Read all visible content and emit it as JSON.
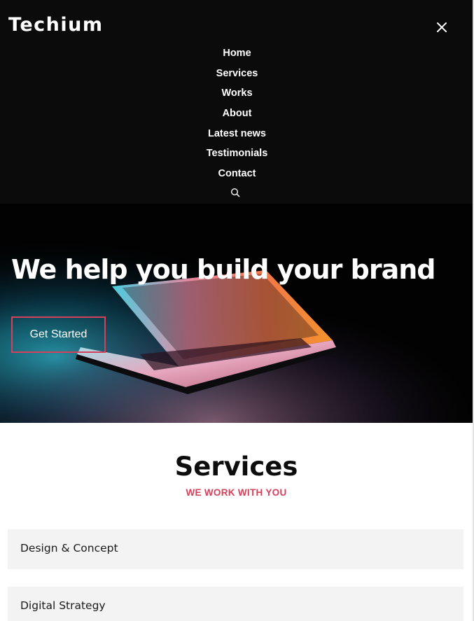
{
  "brand": {
    "logo_text": "Techium"
  },
  "nav": {
    "items": [
      "Home",
      "Services",
      "Works",
      "About",
      "Latest news",
      "Testimonials",
      "Contact"
    ]
  },
  "icons": {
    "close": "close-icon",
    "search": "search-icon"
  },
  "hero": {
    "title": "We help you build your brand",
    "cta_label": "Get Started"
  },
  "services": {
    "title": "Services",
    "subtitle": "WE WORK WITH YOU",
    "items": [
      "Design & Concept",
      "Digital Strategy"
    ]
  },
  "colors": {
    "accent": "#d6405b",
    "nav_bg": "#0b0b0b",
    "card_bg": "#f3f3f3"
  }
}
